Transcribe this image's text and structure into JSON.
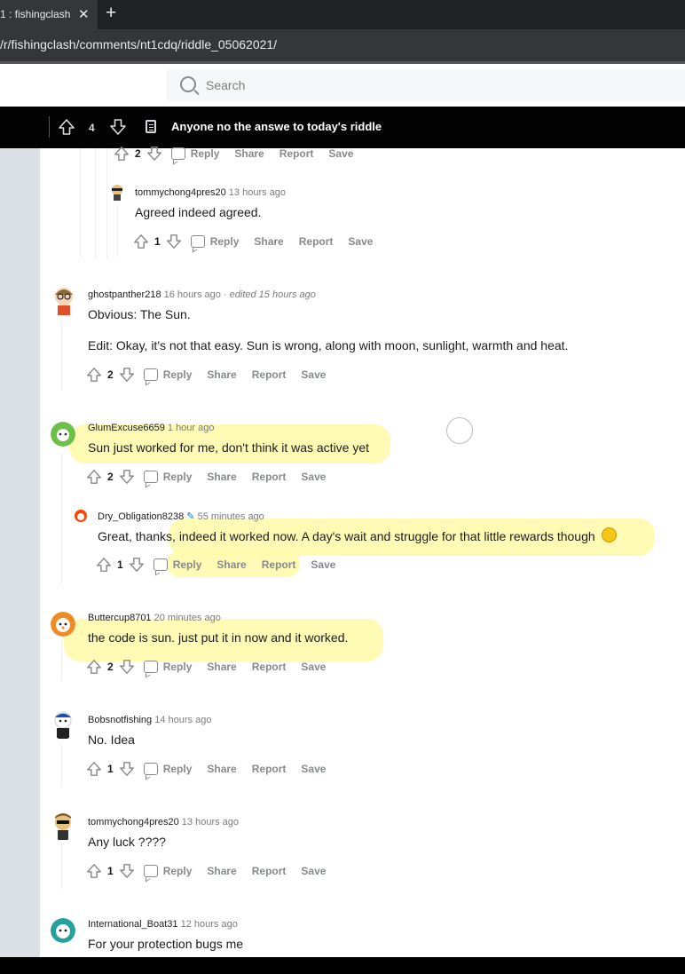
{
  "browser": {
    "tab_title": "1 : fishingclash",
    "tab_close": "✕",
    "new_tab": "+",
    "url": "/r/fishingclash/comments/nt1cdq/riddle_05062021/"
  },
  "header": {
    "search_placeholder": "Search"
  },
  "postbar": {
    "score": "4",
    "title": "Anyone no the answe to today's riddle"
  },
  "action_labels": {
    "reply": "Reply",
    "share": "Share",
    "report": "Report",
    "save": "Save"
  },
  "comments": [
    {
      "user": "",
      "time": "",
      "text": "",
      "score": "2"
    },
    {
      "user": "tommychong4pres20",
      "time": "13 hours ago",
      "text": "Agreed indeed agreed.",
      "score": "1"
    },
    {
      "user": "ghostpanther218",
      "time": "16 hours ago",
      "edited": "edited 15 hours ago",
      "text": "Obvious: The Sun.",
      "text2": "Edit: Okay, it's not that easy. Sun is wrong, along with moon, sunlight, warmth and heat.",
      "score": "2"
    },
    {
      "user": "GlumExcuse6659",
      "time": "1 hour ago",
      "text": "Sun just worked for me, don't think it was active yet",
      "score": "2"
    },
    {
      "user": "Dry_Obligation8238",
      "time": "55 minutes ago",
      "text": "Great, thanks, indeed it worked now. A day's wait and struggle for that little rewards though",
      "score": "1"
    },
    {
      "user": "Buttercup8701",
      "time": "20 minutes ago",
      "text": "the code is sun. just put it in now and it worked.",
      "score": "2"
    },
    {
      "user": "Bobsnotfishing",
      "time": "14 hours ago",
      "text": "No. Idea",
      "score": "1"
    },
    {
      "user": "tommychong4pres20",
      "time": "13 hours ago",
      "text": "Any luck ????",
      "score": "1"
    },
    {
      "user": "International_Boat31",
      "time": "12 hours ago",
      "text": "For your protection bugs me"
    }
  ],
  "icons": {
    "upvote": "upvote-icon",
    "downvote": "downvote-icon",
    "comment": "comment-icon",
    "emoji": "laughing-emoji-icon",
    "pencil": "pencil-icon"
  },
  "colors": {
    "highlight": "#fffaa8",
    "meta_gray": "#7c7c7c",
    "gutter": "#dae0e6"
  }
}
